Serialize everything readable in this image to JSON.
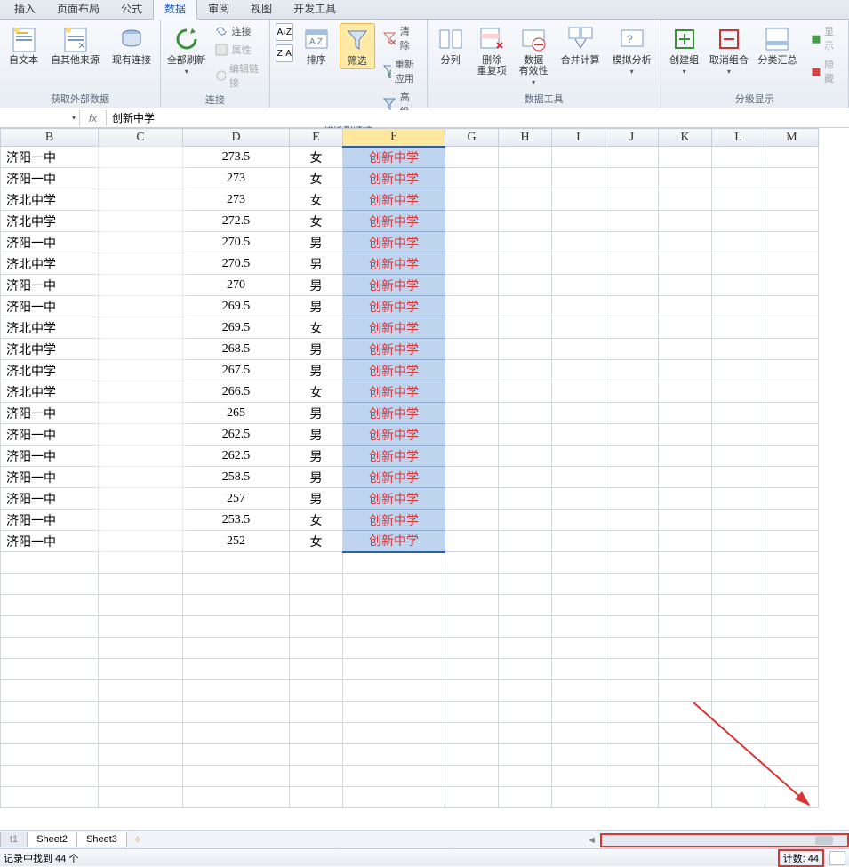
{
  "tabs": [
    "插入",
    "页面布局",
    "公式",
    "数据",
    "审阅",
    "视图",
    "开发工具"
  ],
  "active_tab_index": 3,
  "ribbon": {
    "groups": {
      "external": {
        "label": "获取外部数据",
        "fromtext": "自文本",
        "fromother": "自其他来源",
        "existing": "现有连接"
      },
      "conn": {
        "label": "连接",
        "refreshall": "全部刷新",
        "conns": "连接",
        "props": "属性",
        "editlinks": "编辑链接"
      },
      "sort": {
        "label": "排序和筛选",
        "sort": "排序",
        "filter": "筛选",
        "clear": "清除",
        "reapply": "重新应用",
        "adv": "高级"
      },
      "datatools": {
        "label": "数据工具",
        "texttocol": "分列",
        "removedup": "删除\n重复项",
        "validation": "数据\n有效性",
        "consolidate": "合并计算",
        "whatif": "模拟分析"
      },
      "outline": {
        "label": "分级显示",
        "group": "创建组",
        "ungroup": "取消组合",
        "subtotal": "分类汇总",
        "show": "显示",
        "hide": "隐藏"
      }
    }
  },
  "formula_bar": {
    "name_box": "",
    "fx": "fx",
    "value": "创新中学"
  },
  "columns": [
    "B",
    "C",
    "D",
    "E",
    "F",
    "G",
    "H",
    "I",
    "J",
    "K",
    "L",
    "M"
  ],
  "selected_col": "F",
  "rows": [
    {
      "b": "济阳一中",
      "c": "",
      "d": "273.5",
      "e": "女",
      "f": "创新中学"
    },
    {
      "b": "济阳一中",
      "c": "",
      "d": "273",
      "e": "女",
      "f": "创新中学"
    },
    {
      "b": "济北中学",
      "c": "",
      "d": "273",
      "e": "女",
      "f": "创新中学"
    },
    {
      "b": "济北中学",
      "c": "",
      "d": "272.5",
      "e": "女",
      "f": "创新中学"
    },
    {
      "b": "济阳一中",
      "c": "",
      "d": "270.5",
      "e": "男",
      "f": "创新中学"
    },
    {
      "b": "济北中学",
      "c": "",
      "d": "270.5",
      "e": "男",
      "f": "创新中学"
    },
    {
      "b": "济阳一中",
      "c": "",
      "d": "270",
      "e": "男",
      "f": "创新中学"
    },
    {
      "b": "济阳一中",
      "c": "",
      "d": "269.5",
      "e": "男",
      "f": "创新中学"
    },
    {
      "b": "济北中学",
      "c": "",
      "d": "269.5",
      "e": "女",
      "f": "创新中学"
    },
    {
      "b": "济北中学",
      "c": "",
      "d": "268.5",
      "e": "男",
      "f": "创新中学"
    },
    {
      "b": "济北中学",
      "c": "",
      "d": "267.5",
      "e": "男",
      "f": "创新中学"
    },
    {
      "b": "济北中学",
      "c": "",
      "d": "266.5",
      "e": "女",
      "f": "创新中学"
    },
    {
      "b": "济阳一中",
      "c": "",
      "d": "265",
      "e": "男",
      "f": "创新中学"
    },
    {
      "b": "济阳一中",
      "c": "",
      "d": "262.5",
      "e": "男",
      "f": "创新中学"
    },
    {
      "b": "济阳一中",
      "c": "",
      "d": "262.5",
      "e": "男",
      "f": "创新中学"
    },
    {
      "b": "济阳一中",
      "c": "",
      "d": "258.5",
      "e": "男",
      "f": "创新中学"
    },
    {
      "b": "济阳一中",
      "c": "",
      "d": "257",
      "e": "男",
      "f": "创新中学"
    },
    {
      "b": "济阳一中",
      "c": "",
      "d": "253.5",
      "e": "女",
      "f": "创新中学"
    },
    {
      "b": "济阳一中",
      "c": "",
      "d": "252",
      "e": "女",
      "f": "创新中学"
    }
  ],
  "sheets": {
    "t1": "t1",
    "s2": "Sheet2",
    "s3": "Sheet3"
  },
  "status": {
    "filter_msg": "记录中找到 44 个",
    "count_label": "计数: 44"
  }
}
